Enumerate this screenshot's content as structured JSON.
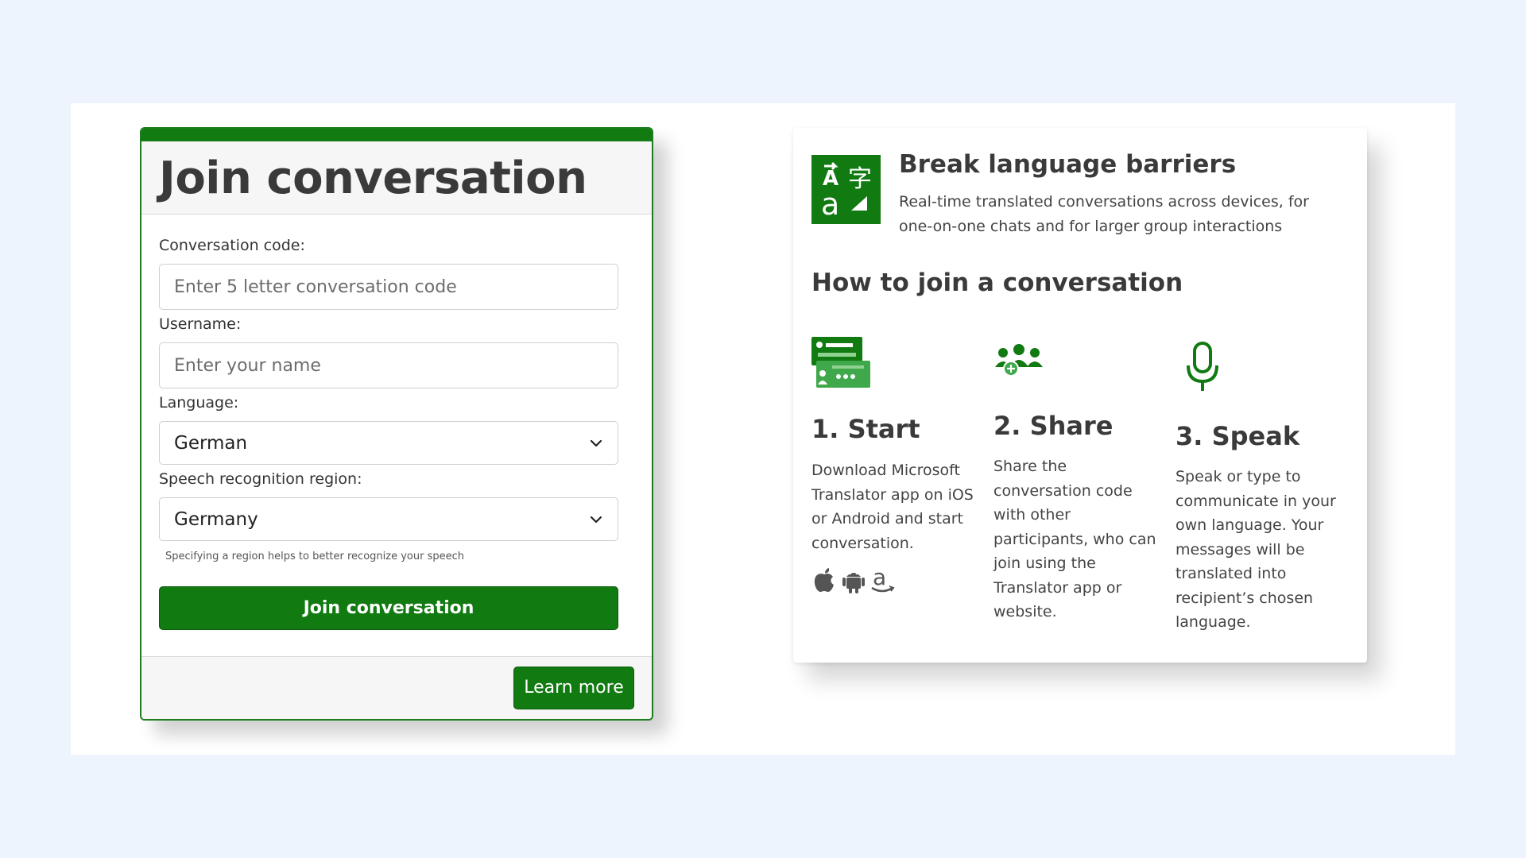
{
  "join": {
    "title": "Join conversation",
    "code_label": "Conversation code:",
    "code_placeholder": "Enter 5 letter conversation code",
    "code_value": "",
    "username_label": "Username:",
    "username_placeholder": "Enter your name",
    "username_value": "",
    "language_label": "Language:",
    "language_selected": "German",
    "region_label": "Speech recognition region:",
    "region_selected": "Germany",
    "region_hint": "Specifying a region helps to better recognize your speech",
    "join_button": "Join conversation",
    "learn_more": "Learn more"
  },
  "info": {
    "title": "Break language barriers",
    "description": "Real-time translated conversations across devices, for one-on-one chats and for larger group interactions",
    "how_title": "How to join a conversation",
    "steps": [
      {
        "title": "1. Start",
        "text": "Download Microsoft Translator app on iOS or Android and start conversation.",
        "icon": "chat-cards-icon"
      },
      {
        "title": "2. Share",
        "text": "Share the conversation code with other participants, who can join using the Translator app or website.",
        "icon": "people-add-icon"
      },
      {
        "title": "3. Speak",
        "text": "Speak or type to communicate in your own language. Your messages will be translated into recipient’s chosen language.",
        "icon": "microphone-icon"
      }
    ],
    "platform_icons": [
      "apple-icon",
      "android-icon",
      "amazon-icon"
    ]
  },
  "colors": {
    "accent": "#117a11",
    "background": "#eef4fd",
    "text": "#333333"
  }
}
